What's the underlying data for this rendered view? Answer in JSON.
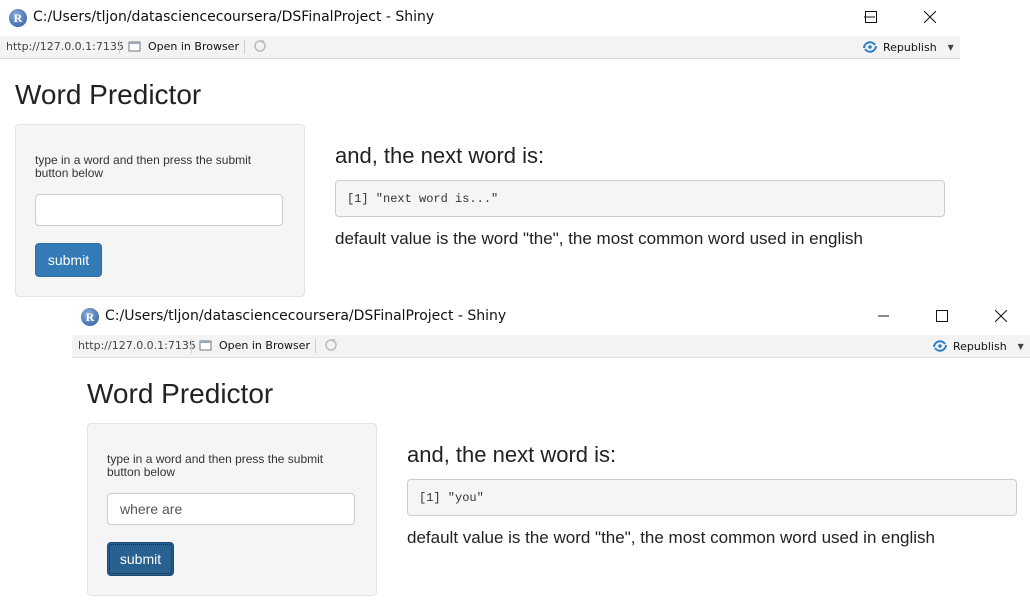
{
  "windows": [
    {
      "title": "C:/Users/tljon/datasciencecoursera/DSFinalProject - Shiny",
      "address": {
        "url": "http://127.0.0.1:7135",
        "open_in_browser": "Open in Browser",
        "republish": "Republish"
      },
      "app": {
        "title": "Word Predictor",
        "input_label": "type in a word and then press the submit button below",
        "input_value": "",
        "submit_label": "submit",
        "heading": "and, the next word is:",
        "output": "[1] \"next word is...\"",
        "note": "default value is the word \"the\", the most common word used in english"
      }
    },
    {
      "title": "C:/Users/tljon/datasciencecoursera/DSFinalProject - Shiny",
      "address": {
        "url": "http://127.0.0.1:7135",
        "open_in_browser": "Open in Browser",
        "republish": "Republish"
      },
      "app": {
        "title": "Word Predictor",
        "input_label": "type in a word and then press the submit button below",
        "input_value": "where are",
        "submit_label": "submit",
        "heading": "and, the next word is:",
        "output": "[1] \"you\"",
        "note": "default value is the word \"the\", the most common word used in english"
      }
    }
  ],
  "icons": {
    "app_logo": "r-logo-icon",
    "open_in_browser": "browser-window-icon",
    "refresh": "refresh-icon",
    "republish": "republish-icon",
    "window_controls": [
      "minimize-icon",
      "maximize-icon",
      "close-icon"
    ]
  },
  "colors": {
    "primary_button": "#337ab7",
    "primary_button_active": "#286090",
    "republish_icon": "#2d7dc4"
  }
}
